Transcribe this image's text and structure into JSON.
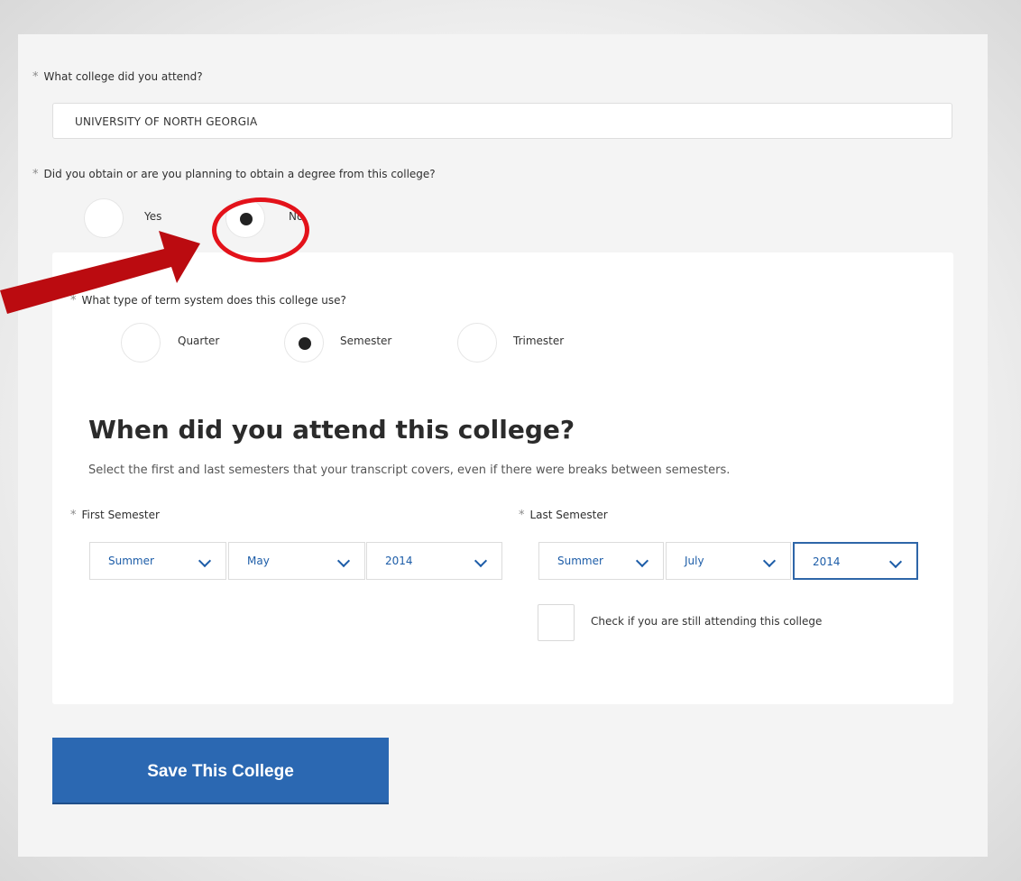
{
  "form": {
    "college_question": "What college did you attend?",
    "college_value": "UNIVERSITY OF NORTH GEORGIA",
    "degree_question": "Did you obtain or are you planning to obtain a degree from this college?",
    "degree_options": [
      {
        "label": "Yes",
        "selected": false
      },
      {
        "label": "No",
        "selected": true
      }
    ],
    "term_question": "What type of term system does this college use?",
    "term_options": [
      {
        "label": "Quarter",
        "selected": false
      },
      {
        "label": "Semester",
        "selected": true
      },
      {
        "label": "Trimester",
        "selected": false
      }
    ],
    "required_mark": "*"
  },
  "attendance": {
    "heading": "When did you attend this college?",
    "helper": "Select the first and last semesters that your transcript covers, even if there were breaks between semesters.",
    "first_label": "First Semester",
    "first": {
      "term": "Summer",
      "month": "May",
      "year": "2014"
    },
    "last_label": "Last Semester",
    "last": {
      "term": "Summer",
      "month": "July",
      "year": "2014"
    },
    "still_attending_label": "Check if you are still attending this college",
    "still_attending_checked": false
  },
  "save_label": "Save This College",
  "colors": {
    "accent": "#2b68b2",
    "link": "#1d5da8",
    "annotation": "#e3121a"
  }
}
